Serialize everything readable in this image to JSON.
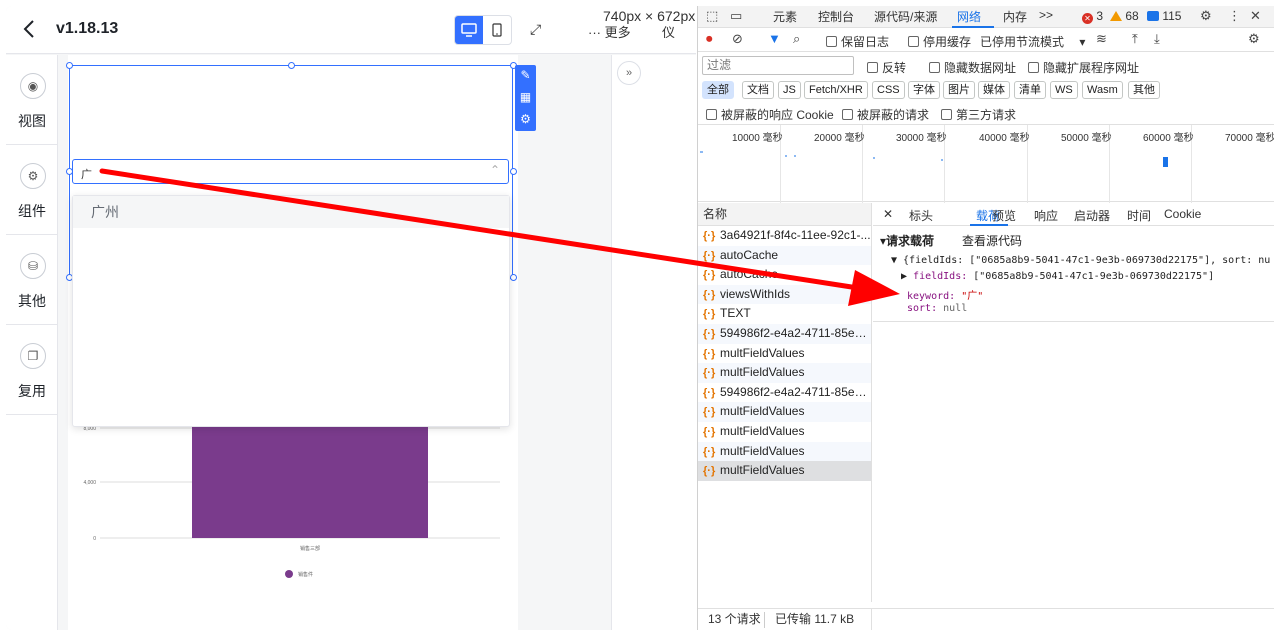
{
  "app": {
    "version": "v1.18.13",
    "size_label": "740px × 672px",
    "more_label": "··· 更多",
    "dash_label": "仪",
    "rail": [
      {
        "label": "视图"
      },
      {
        "label": "组件"
      },
      {
        "label": "其他"
      },
      {
        "label": "复用"
      }
    ],
    "combo_value": "广",
    "dropdown_option": "广州",
    "chart": {
      "tick_top": "8,000",
      "tick_mid": "4,000",
      "tick_zero": "0",
      "category": "销售三部",
      "legend": "销售件",
      "bar_color": "#7a3b8c"
    }
  },
  "devtools": {
    "tabs": [
      "元素",
      "控制台",
      "源代码/来源",
      "网络",
      "内存"
    ],
    "active_tab": "网络",
    "more_tabs": ">>",
    "errors": "3",
    "warnings": "68",
    "messages": "115",
    "toolbar": {
      "preserve_log": "保留日志",
      "disable_cache": "停用缓存",
      "throttle": "已停用节流模式"
    },
    "filter": {
      "placeholder": "过滤",
      "invert": "反转",
      "hide_data_urls": "隐藏数据网址",
      "hide_ext_urls": "隐藏扩展程序网址"
    },
    "types": [
      "全部",
      "文档",
      "JS",
      "Fetch/XHR",
      "CSS",
      "字体",
      "图片",
      "媒体",
      "清单",
      "WS",
      "Wasm",
      "其他"
    ],
    "options": {
      "blocked_cookie": "被屏蔽的响应 Cookie",
      "blocked_requests": "被屏蔽的请求",
      "third_party": "第三方请求"
    },
    "timeline_labels": [
      "10000 毫秒",
      "20000 毫秒",
      "30000 毫秒",
      "40000 毫秒",
      "50000 毫秒",
      "60000 毫秒",
      "70000 毫秒"
    ],
    "list_header": "名称",
    "requests": [
      "3a64921f-8f4c-11ee-92c1-...",
      "autoCache",
      "autoCache",
      "viewsWithIds",
      "TEXT",
      "594986f2-e4a2-4711-85e3...",
      "multFieldValues",
      "multFieldValues",
      "594986f2-e4a2-4711-85e3...",
      "multFieldValues",
      "multFieldValues",
      "multFieldValues",
      "multFieldValues"
    ],
    "detail_tabs": [
      "标头",
      "载荷",
      "预览",
      "响应",
      "启动器",
      "时间",
      "Cookie"
    ],
    "active_detail_tab": "载荷",
    "payload": {
      "title": "▾请求载荷",
      "view_source": "查看源代码",
      "line1": "▼ {fieldIds: [\"0685a8b9-5041-47c1-9e3b-069730d22175\"], sort: nu",
      "line2_key": "fieldIds:",
      "line2_val": "[\"0685a8b9-5041-47c1-9e3b-069730d22175\"]",
      "line3_key": "keyword:",
      "line3_val": "\"广\"",
      "line4_key": "sort:",
      "line4_val": "null"
    },
    "status": {
      "requests": "13 个请求",
      "transferred": "已传输 11.7 kB"
    }
  },
  "colors": {
    "accent": "#3370ff",
    "devtools_blue": "#1a73e8",
    "arrow": "#ff0000"
  }
}
